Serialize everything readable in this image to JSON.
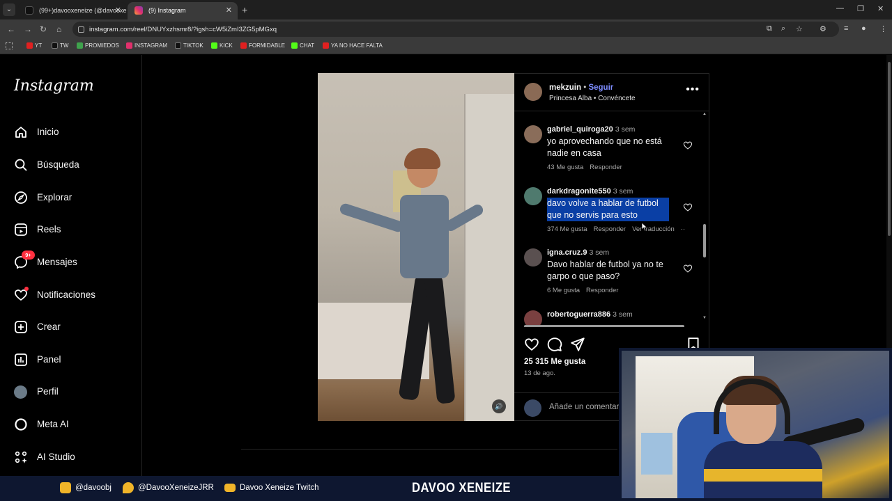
{
  "browser": {
    "tabs": [
      {
        "title": "(99+)davooxeneize (@davooxe",
        "active": false
      },
      {
        "title": "(9) Instagram",
        "active": true
      }
    ],
    "url": "instagram.com/reel/DNUYxzhsmr8/?igsh=cW5iZmI3ZG5pMGxq",
    "bookmarks": [
      "YT",
      "TW",
      "PROMIEDOS",
      "INSTAGRAM",
      "TIKTOK",
      "KICK",
      "FORMIDABLE",
      "CHAT",
      "YA NO HACE FALTA"
    ]
  },
  "sidebar": {
    "logo": "Instagram",
    "items": [
      {
        "label": "Inicio",
        "icon": "home-icon"
      },
      {
        "label": "Búsqueda",
        "icon": "search-icon"
      },
      {
        "label": "Explorar",
        "icon": "compass-icon"
      },
      {
        "label": "Reels",
        "icon": "reels-icon"
      },
      {
        "label": "Mensajes",
        "icon": "messenger-icon",
        "badge": "9+"
      },
      {
        "label": "Notificaciones",
        "icon": "heart-icon"
      },
      {
        "label": "Crear",
        "icon": "plus-icon"
      },
      {
        "label": "Panel",
        "icon": "chart-icon"
      },
      {
        "label": "Perfil",
        "icon": "avatar"
      },
      {
        "label": "Meta AI",
        "icon": "ring-icon"
      },
      {
        "label": "AI Studio",
        "icon": "sparkle-grid-icon"
      }
    ]
  },
  "post": {
    "author": "mekzuin",
    "separator": "•",
    "follow_label": "Seguir",
    "audio": "Princesa Alba • Convéncete",
    "likes": "25 315 Me gusta",
    "date": "13 de ago.",
    "add_comment_placeholder": "Añade un comentario..."
  },
  "comments": [
    {
      "user": "gabriel_quiroga20",
      "time": "3 sem",
      "text": "yo aprovechando que no está nadie en casa",
      "likes": "43 Me gusta",
      "reply": "Responder",
      "translate": "",
      "highlighted": false
    },
    {
      "user": "darkdragonite550",
      "time": "3 sem",
      "text": "davo volve a hablar de futbol que no servis para esto",
      "likes": "374 Me gusta",
      "reply": "Responder",
      "translate": "Ver traducción",
      "highlighted": true
    },
    {
      "user": "igna.cruz.9",
      "time": "3 sem",
      "text": "Davo hablar de futbol ya no te garpo o que paso?",
      "likes": "6 Me gusta",
      "reply": "Responder",
      "translate": "",
      "highlighted": false
    },
    {
      "user": "robertoguerra886",
      "time": "3 sem",
      "text": "",
      "likes": "",
      "reply": "",
      "translate": "",
      "highlighted": false
    }
  ],
  "footer": {
    "instagram": "@davoobj",
    "twitter": "@DavooXeneizeJRR",
    "youtube": "Davoo Xeneize Twitch",
    "brand": "DAVOO XENEIZE"
  },
  "colors": {
    "follow": "#7d8cff",
    "badge": "#ff3040",
    "highlight": "#0a3fa5",
    "footer_bg": "#0e1730"
  }
}
